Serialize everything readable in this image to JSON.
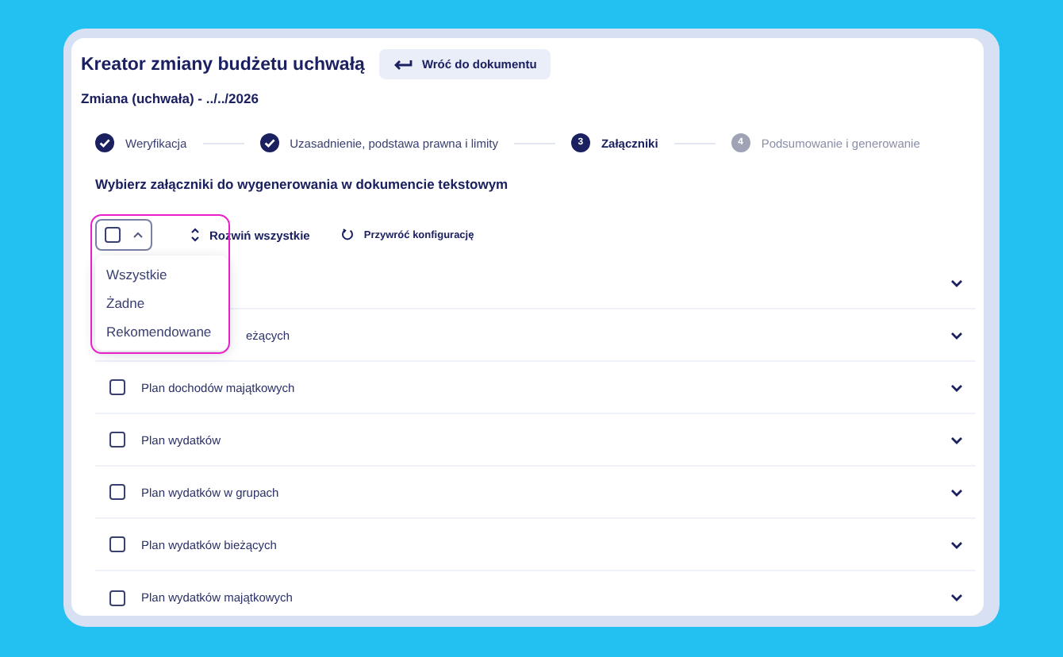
{
  "title": "Kreator zmiany budżetu uchwałą",
  "back_button": {
    "label": "Wróć do dokumentu"
  },
  "subtitle": "Zmiana (uchwała) - ../../2026",
  "steps": [
    {
      "label": "Weryfikacja",
      "done": true,
      "selected": false
    },
    {
      "label": "Uzasadnienie, podstawa prawna i limity",
      "done": true,
      "selected": false
    },
    {
      "number": "3",
      "label": "Załączniki",
      "done": false,
      "selected": true
    },
    {
      "number": "4",
      "label": "Podsumowanie i generowanie",
      "done": false,
      "selected": false
    }
  ],
  "heading": "Wybierz załączniki do wygenerowania w dokumencie tekstowym",
  "toolbar": {
    "select_all_checked": false,
    "expand_label": "Rozwiń wszystkie",
    "reset_label": "Przywróć konfigurację"
  },
  "dropdown": {
    "options": [
      {
        "label": "Wszystkie"
      },
      {
        "label": "Żadne"
      },
      {
        "label": "Rekomendowane"
      }
    ]
  },
  "rows": [
    {
      "expanded": false
    },
    {
      "label": "eżących",
      "expanded": false
    },
    {
      "label": "Plan dochodów majątkowych",
      "checked": false,
      "expanded": false
    },
    {
      "label": "Plan wydatków",
      "checked": false,
      "expanded": false
    },
    {
      "label": "Plan wydatków w grupach",
      "checked": false,
      "expanded": false
    },
    {
      "label": "Plan wydatków bieżących",
      "checked": false,
      "expanded": false
    },
    {
      "label": "Plan wydatków majątkowych",
      "checked": false,
      "expanded": false
    }
  ]
}
